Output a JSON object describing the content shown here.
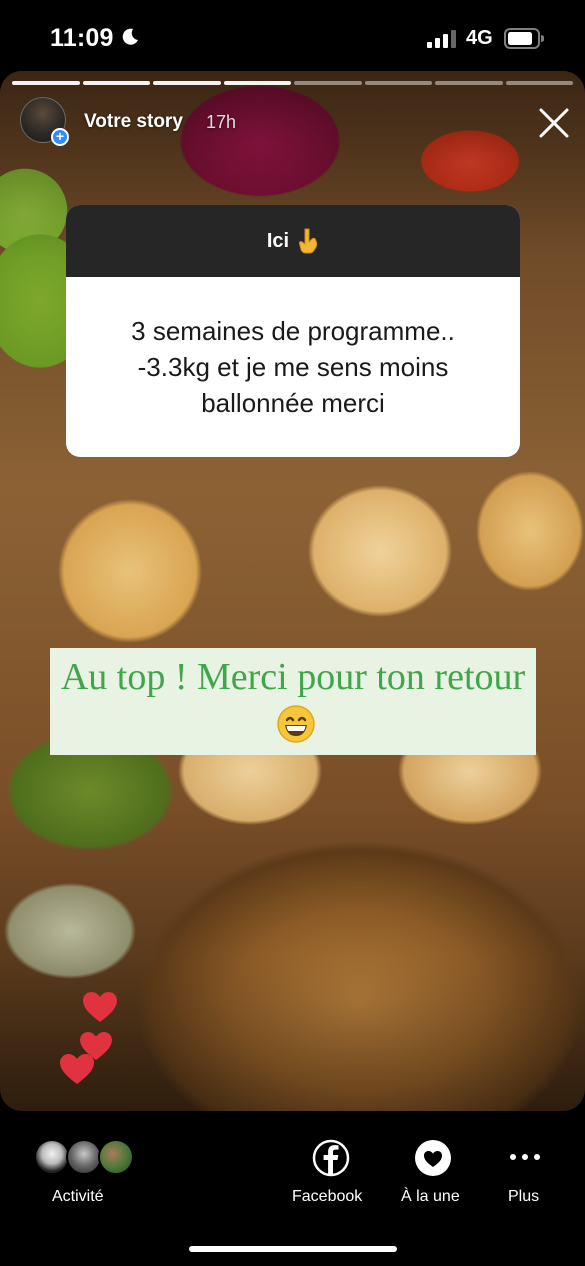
{
  "status_bar": {
    "time": "11:09",
    "network": "4G"
  },
  "story": {
    "user": "Votre story",
    "age": "17h",
    "segments_total": 8,
    "segments_done": 4
  },
  "question_sticker": {
    "title": "Ici",
    "answer": "3 semaines de programme..\n-3.3kg et je me sens moins\nballonnée merci"
  },
  "reply": {
    "text": "Au top ! Merci pour ton retour"
  },
  "colors": {
    "sticker_header": "#262626",
    "reply_text": "#3fa64a",
    "reply_bg": "#e9f3e3",
    "heart": "#e0323f",
    "facebook_accent": "#ffffff"
  },
  "bottom_bar": {
    "activity": "Activité",
    "facebook": "Facebook",
    "highlight": "À la une",
    "more": "Plus"
  }
}
